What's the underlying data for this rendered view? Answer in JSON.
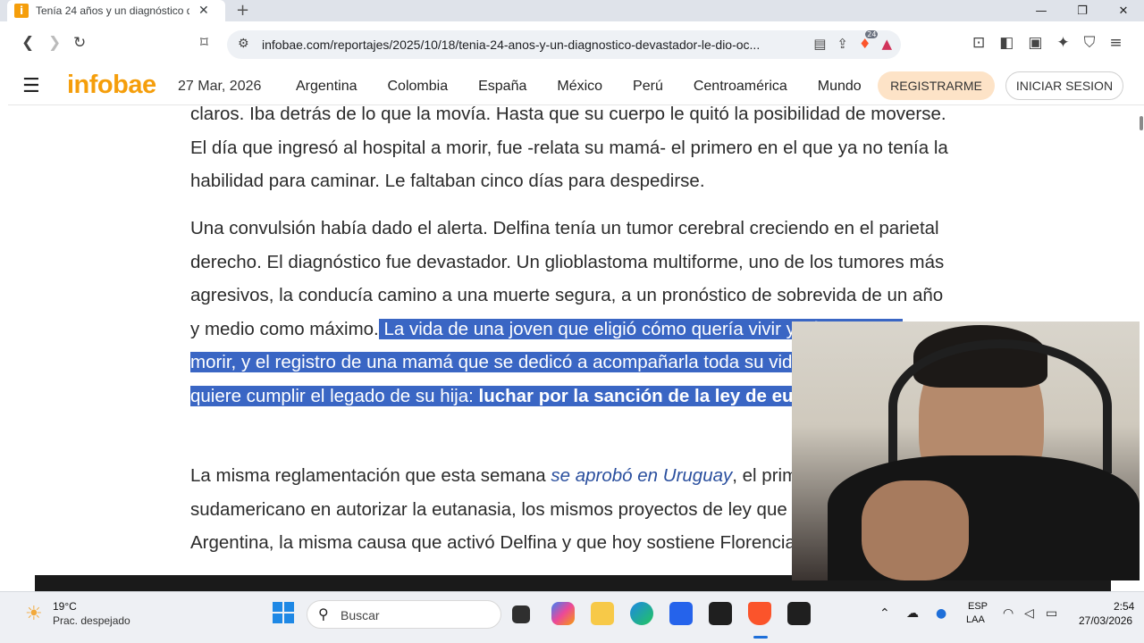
{
  "browser": {
    "tab_title": "Tenía 24 años y un diagnóstico d",
    "tab_favicon": "i",
    "url": "infobae.com/reportajes/2025/10/18/tenia-24-anos-y-un-diagnostico-devastador-le-dio-oc...",
    "brave_shield_count": "24"
  },
  "site": {
    "logo": "infobae",
    "date": "27 Mar, 2026",
    "nav": [
      "Argentina",
      "Colombia",
      "España",
      "México",
      "Perú",
      "Centroamérica",
      "Mundo"
    ],
    "register_label": "REGISTRARME",
    "login_label": "INICIAR SESION"
  },
  "article": {
    "p1": "claros. Iba detrás de lo que la movía. Hasta que su cuerpo le quitó la posibilidad de moverse. El día que ingresó al hospital a morir, fue -relata su mamá- el primero en el que ya no tenía la habilidad para caminar. Le faltaban cinco días para despedirse.",
    "p2_plain": "Una convulsión había dado el alerta. Delfina tenía un tumor cerebral creciendo en el parietal derecho. El diagnóstico fue devastador. Un glioblastoma multiforme, uno de los tumores más agresivos, la conducía camino a una muerte segura, a un pronóstico de sobrevida de un año y medio como máximo.",
    "p2_selected": " La vida de una joven que eligió cómo quería vivir y cómo quería morir, y el registro de una mamá que se dedicó a acompañarla toda su vida y que ahora quiere cumplir el legado de su hija: ",
    "p2_selected_bold": "luchar por la sanción de la ley de eutanasia",
    "p2_end": ".",
    "p3_start": "La misma reglamentación que esta semana ",
    "p3_link": "se aprobó en Uruguay",
    "p3_end": ", el primer país sudamericano en autorizar la eutanasia, los mismos proyectos de ley que se debaten en Argentina, la misma causa que activó Delfina y que hoy sostiene Florencia."
  },
  "taskbar": {
    "temp": "19°C",
    "weather": "Prac. despejado",
    "search_placeholder": "Buscar",
    "lang_top": "ESP",
    "lang_bottom": "LAA",
    "time": "2:54",
    "date": "27/03/2026"
  },
  "colors": {
    "brand": "#f59e0b",
    "selection": "#3a66c4",
    "link": "#2a4f9e"
  }
}
